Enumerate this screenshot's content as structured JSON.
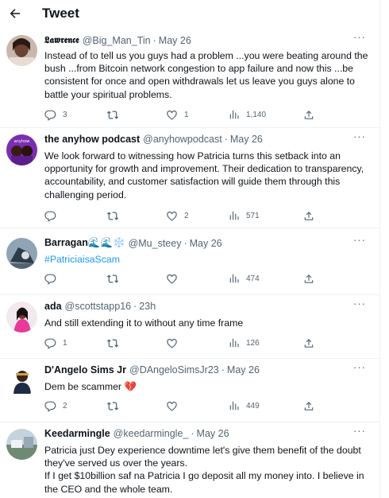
{
  "header": {
    "title": "Tweet"
  },
  "tweets": [
    {
      "name": "𝕷𝖆𝖜𝖗𝖊𝖓𝖈𝖊",
      "handle": "@Big_Man_Tin",
      "time": "May 26",
      "text": "Instead of to tell us you guys had a problem ...you were beating around the bush ...from Bitcoin network congestion to app failure and now this ...be consistent for once and open withdrawals let us leave you guys alone to battle your spiritual problems.",
      "replies": "3",
      "retweets": "",
      "likes": "1",
      "views": "1,140"
    },
    {
      "name": "the anyhow podcast",
      "handle": "@anyhowpodcast",
      "time": "May 26",
      "text": "We look forward to witnessing how Patricia turns this setback into an opportunity for growth and improvement. Their dedication to transparency, accountability, and customer satisfaction will guide them through this challenging period.",
      "replies": "",
      "retweets": "",
      "likes": "2",
      "views": "571"
    },
    {
      "name": "Barragan🌊🌊❄️",
      "handle": "@Mu_steey",
      "time": "May 26",
      "text": "#PatriciaisaScam",
      "replies": "",
      "retweets": "",
      "likes": "",
      "views": "474"
    },
    {
      "name": "ada",
      "handle": "@scottstapp16",
      "time": "23h",
      "text": "And still extending it to without any time frame",
      "replies": "1",
      "retweets": "",
      "likes": "",
      "views": "126"
    },
    {
      "name": "D'Angelo Sims Jr",
      "handle": "@DAngeloSimsJr23",
      "time": "May 26",
      "text": "Dem be scammer 💔",
      "replies": "2",
      "retweets": "",
      "likes": "",
      "views": "449"
    },
    {
      "name": "Keedarmingle",
      "handle": "@keedarmingle_",
      "time": "May 26",
      "text": "Patricia just Dey experience downtime let's give them benefit of the doubt they've served us over the years.",
      "text2": "If I get $10billion saf na Patricia I go deposit all my money into. I believe in the CEO and the whole team."
    }
  ],
  "colors": {
    "text": "#0f1419",
    "muted": "#536471",
    "link": "#1d9bf0",
    "border": "#eff3f4"
  }
}
